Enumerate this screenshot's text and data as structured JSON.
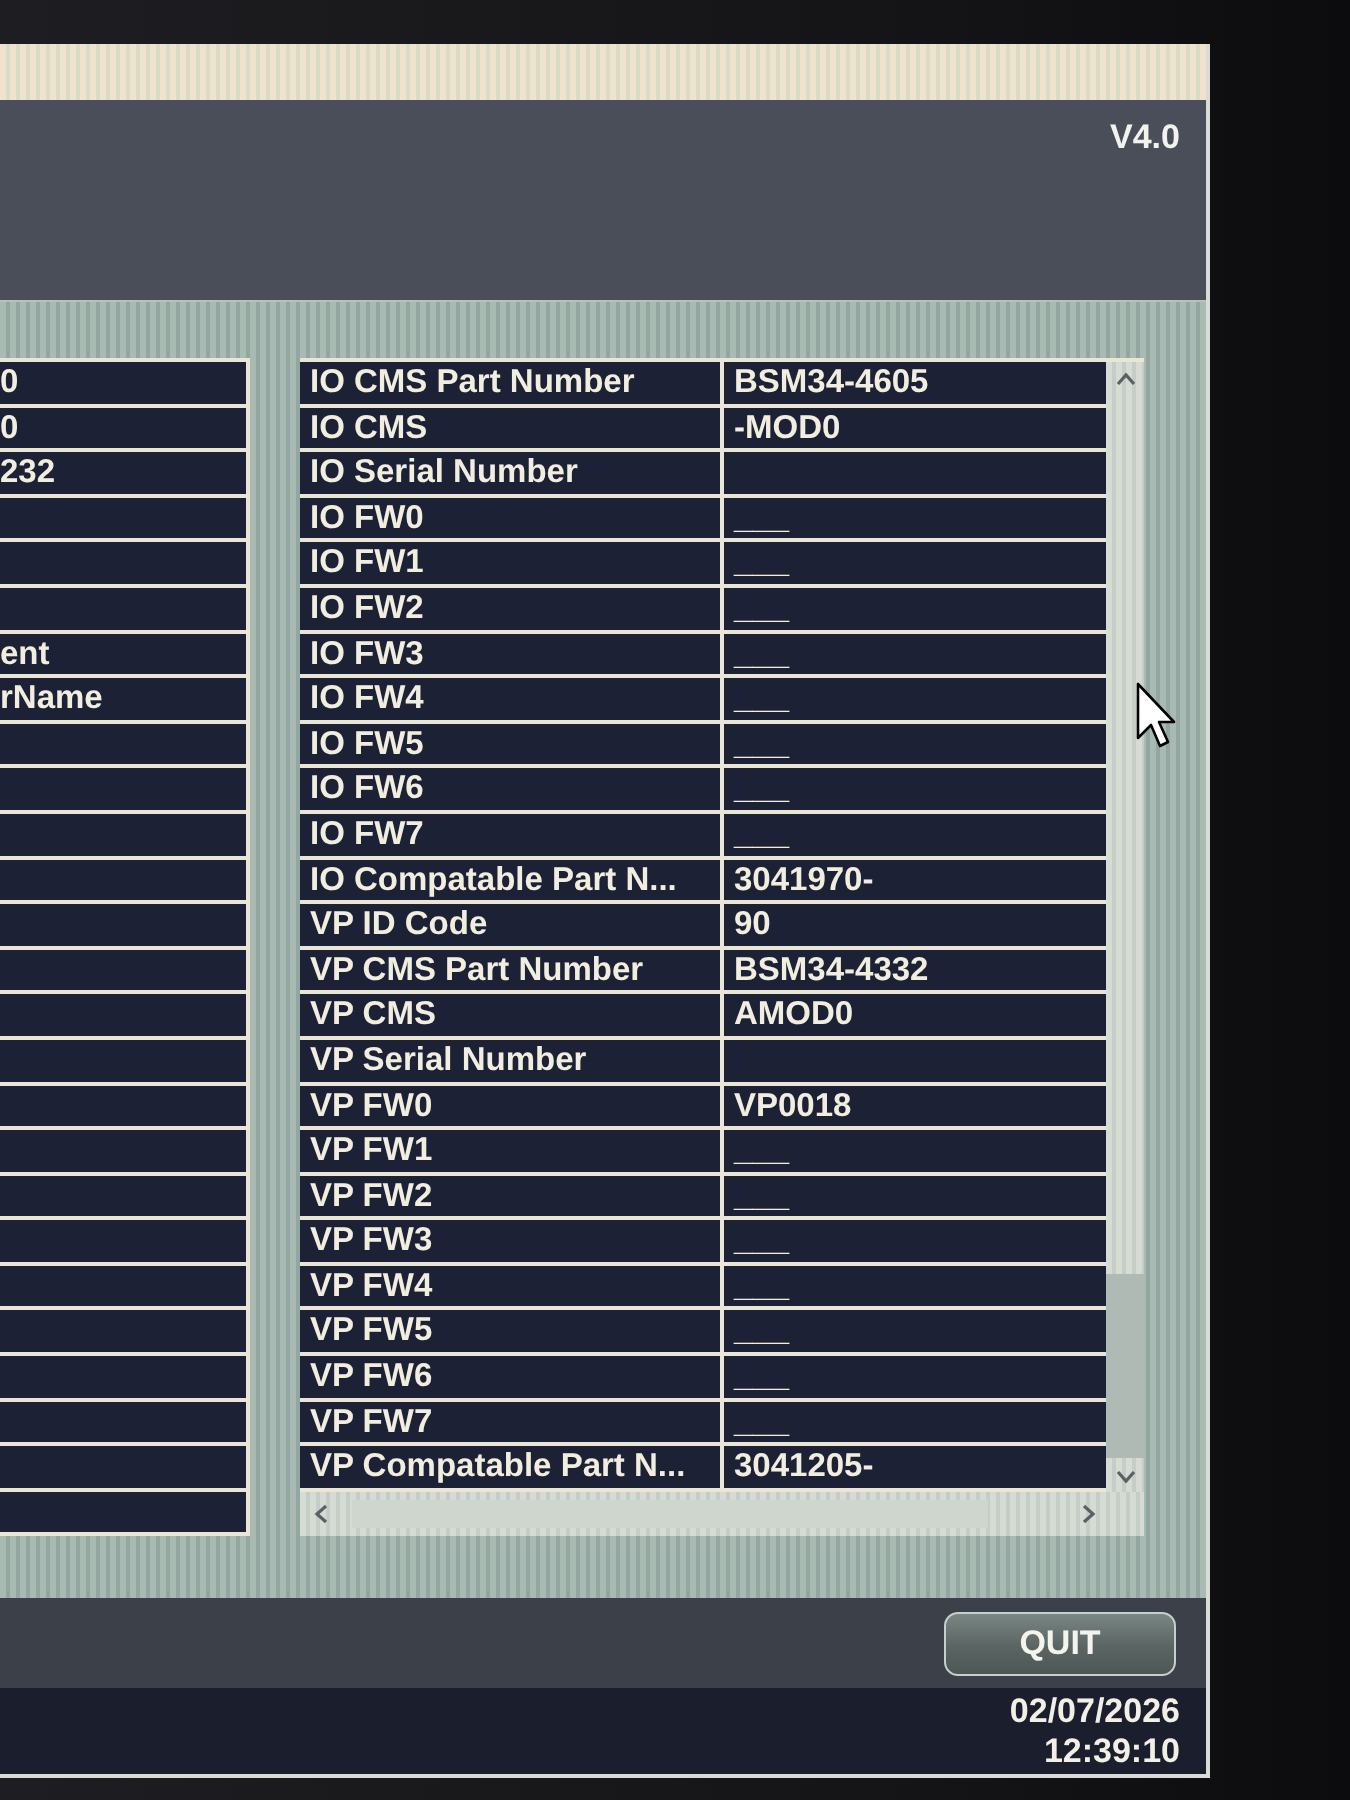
{
  "header": {
    "version": "V4.0"
  },
  "left_table": {
    "rows": [
      {
        "value": "0"
      },
      {
        "value": "0"
      },
      {
        "value": "232"
      },
      {},
      {},
      {},
      {
        "value": "ent"
      },
      {
        "value": "rName"
      },
      {},
      {},
      {},
      {},
      {},
      {},
      {},
      {},
      {},
      {},
      {},
      {},
      {},
      {},
      {},
      {},
      {},
      {}
    ]
  },
  "details_table": {
    "rows": [
      {
        "name": "IO CMS Part Number",
        "value": "BSM34-4605"
      },
      {
        "name": "IO CMS",
        "value": "-MOD0"
      },
      {
        "name": "IO Serial Number"
      },
      {
        "name": "IO FW0",
        "value": "___"
      },
      {
        "name": "IO FW1",
        "value": "___"
      },
      {
        "name": "IO FW2",
        "value": "___"
      },
      {
        "name": "IO FW3",
        "value": "___"
      },
      {
        "name": "IO FW4",
        "value": "___"
      },
      {
        "name": "IO FW5",
        "value": "___"
      },
      {
        "name": "IO FW6",
        "value": "___"
      },
      {
        "name": "IO FW7",
        "value": "___"
      },
      {
        "name": "IO Compatable Part N...",
        "value": "3041970-"
      },
      {
        "name": "VP ID Code",
        "value": "90"
      },
      {
        "name": "VP CMS Part Number",
        "value": "BSM34-4332"
      },
      {
        "name": "VP CMS",
        "value": "AMOD0"
      },
      {
        "name": "VP Serial Number"
      },
      {
        "name": "VP FW0",
        "value": "VP0018"
      },
      {
        "name": "VP FW1",
        "value": "___"
      },
      {
        "name": "VP FW2",
        "value": "___"
      },
      {
        "name": "VP FW3",
        "value": "___"
      },
      {
        "name": "VP FW4",
        "value": "___"
      },
      {
        "name": "VP FW5",
        "value": "___"
      },
      {
        "name": "VP FW6",
        "value": "___"
      },
      {
        "name": "VP FW7",
        "value": "___"
      },
      {
        "name": "VP Compatable Part N...",
        "value": "3041205-"
      }
    ]
  },
  "footer": {
    "buttons": [
      {
        "label": "QUIT"
      }
    ]
  },
  "status_bar": {
    "date": "02/07/2026",
    "time": "12:39:10"
  }
}
